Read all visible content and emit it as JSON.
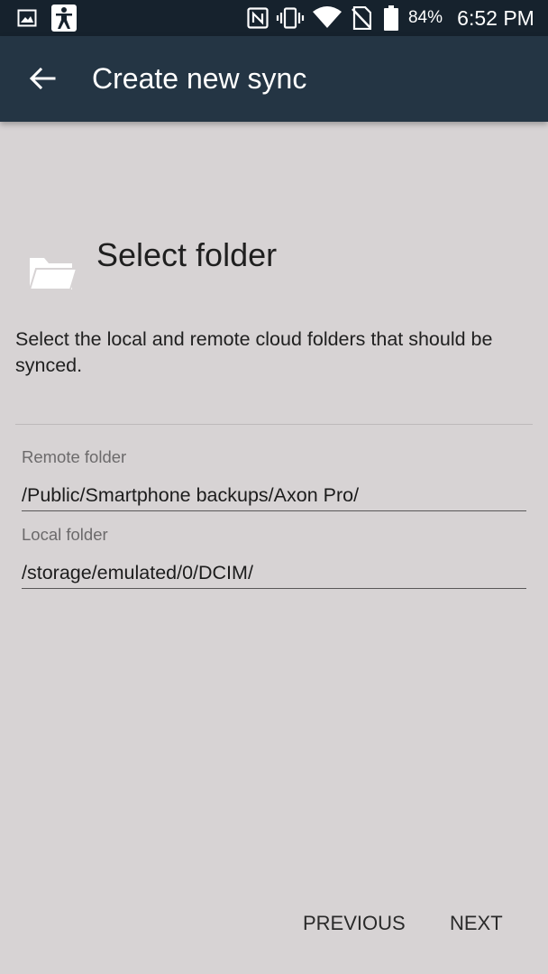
{
  "status_bar": {
    "battery_percent": "84%",
    "time": "6:52 PM",
    "icons": [
      "image-icon",
      "accessibility-icon",
      "nfc-icon",
      "vibrate-icon",
      "wifi-icon",
      "no-sim-icon",
      "battery-icon"
    ]
  },
  "app_bar": {
    "title": "Create new sync",
    "back_icon": "arrow-left-icon"
  },
  "step": {
    "icon": "folder-open-icon",
    "title": "Select folder",
    "description": "Select the local and remote cloud folders that should be synced."
  },
  "fields": {
    "remote": {
      "label": "Remote folder",
      "value": "/Public/Smartphone backups/Axon Pro/"
    },
    "local": {
      "label": "Local folder",
      "value": "/storage/emulated/0/DCIM/"
    }
  },
  "footer": {
    "previous_label": "PREVIOUS",
    "next_label": "NEXT"
  },
  "colors": {
    "status_bar_bg": "#16222d",
    "app_bar_bg": "#243544",
    "page_bg": "#d7d3d4"
  }
}
